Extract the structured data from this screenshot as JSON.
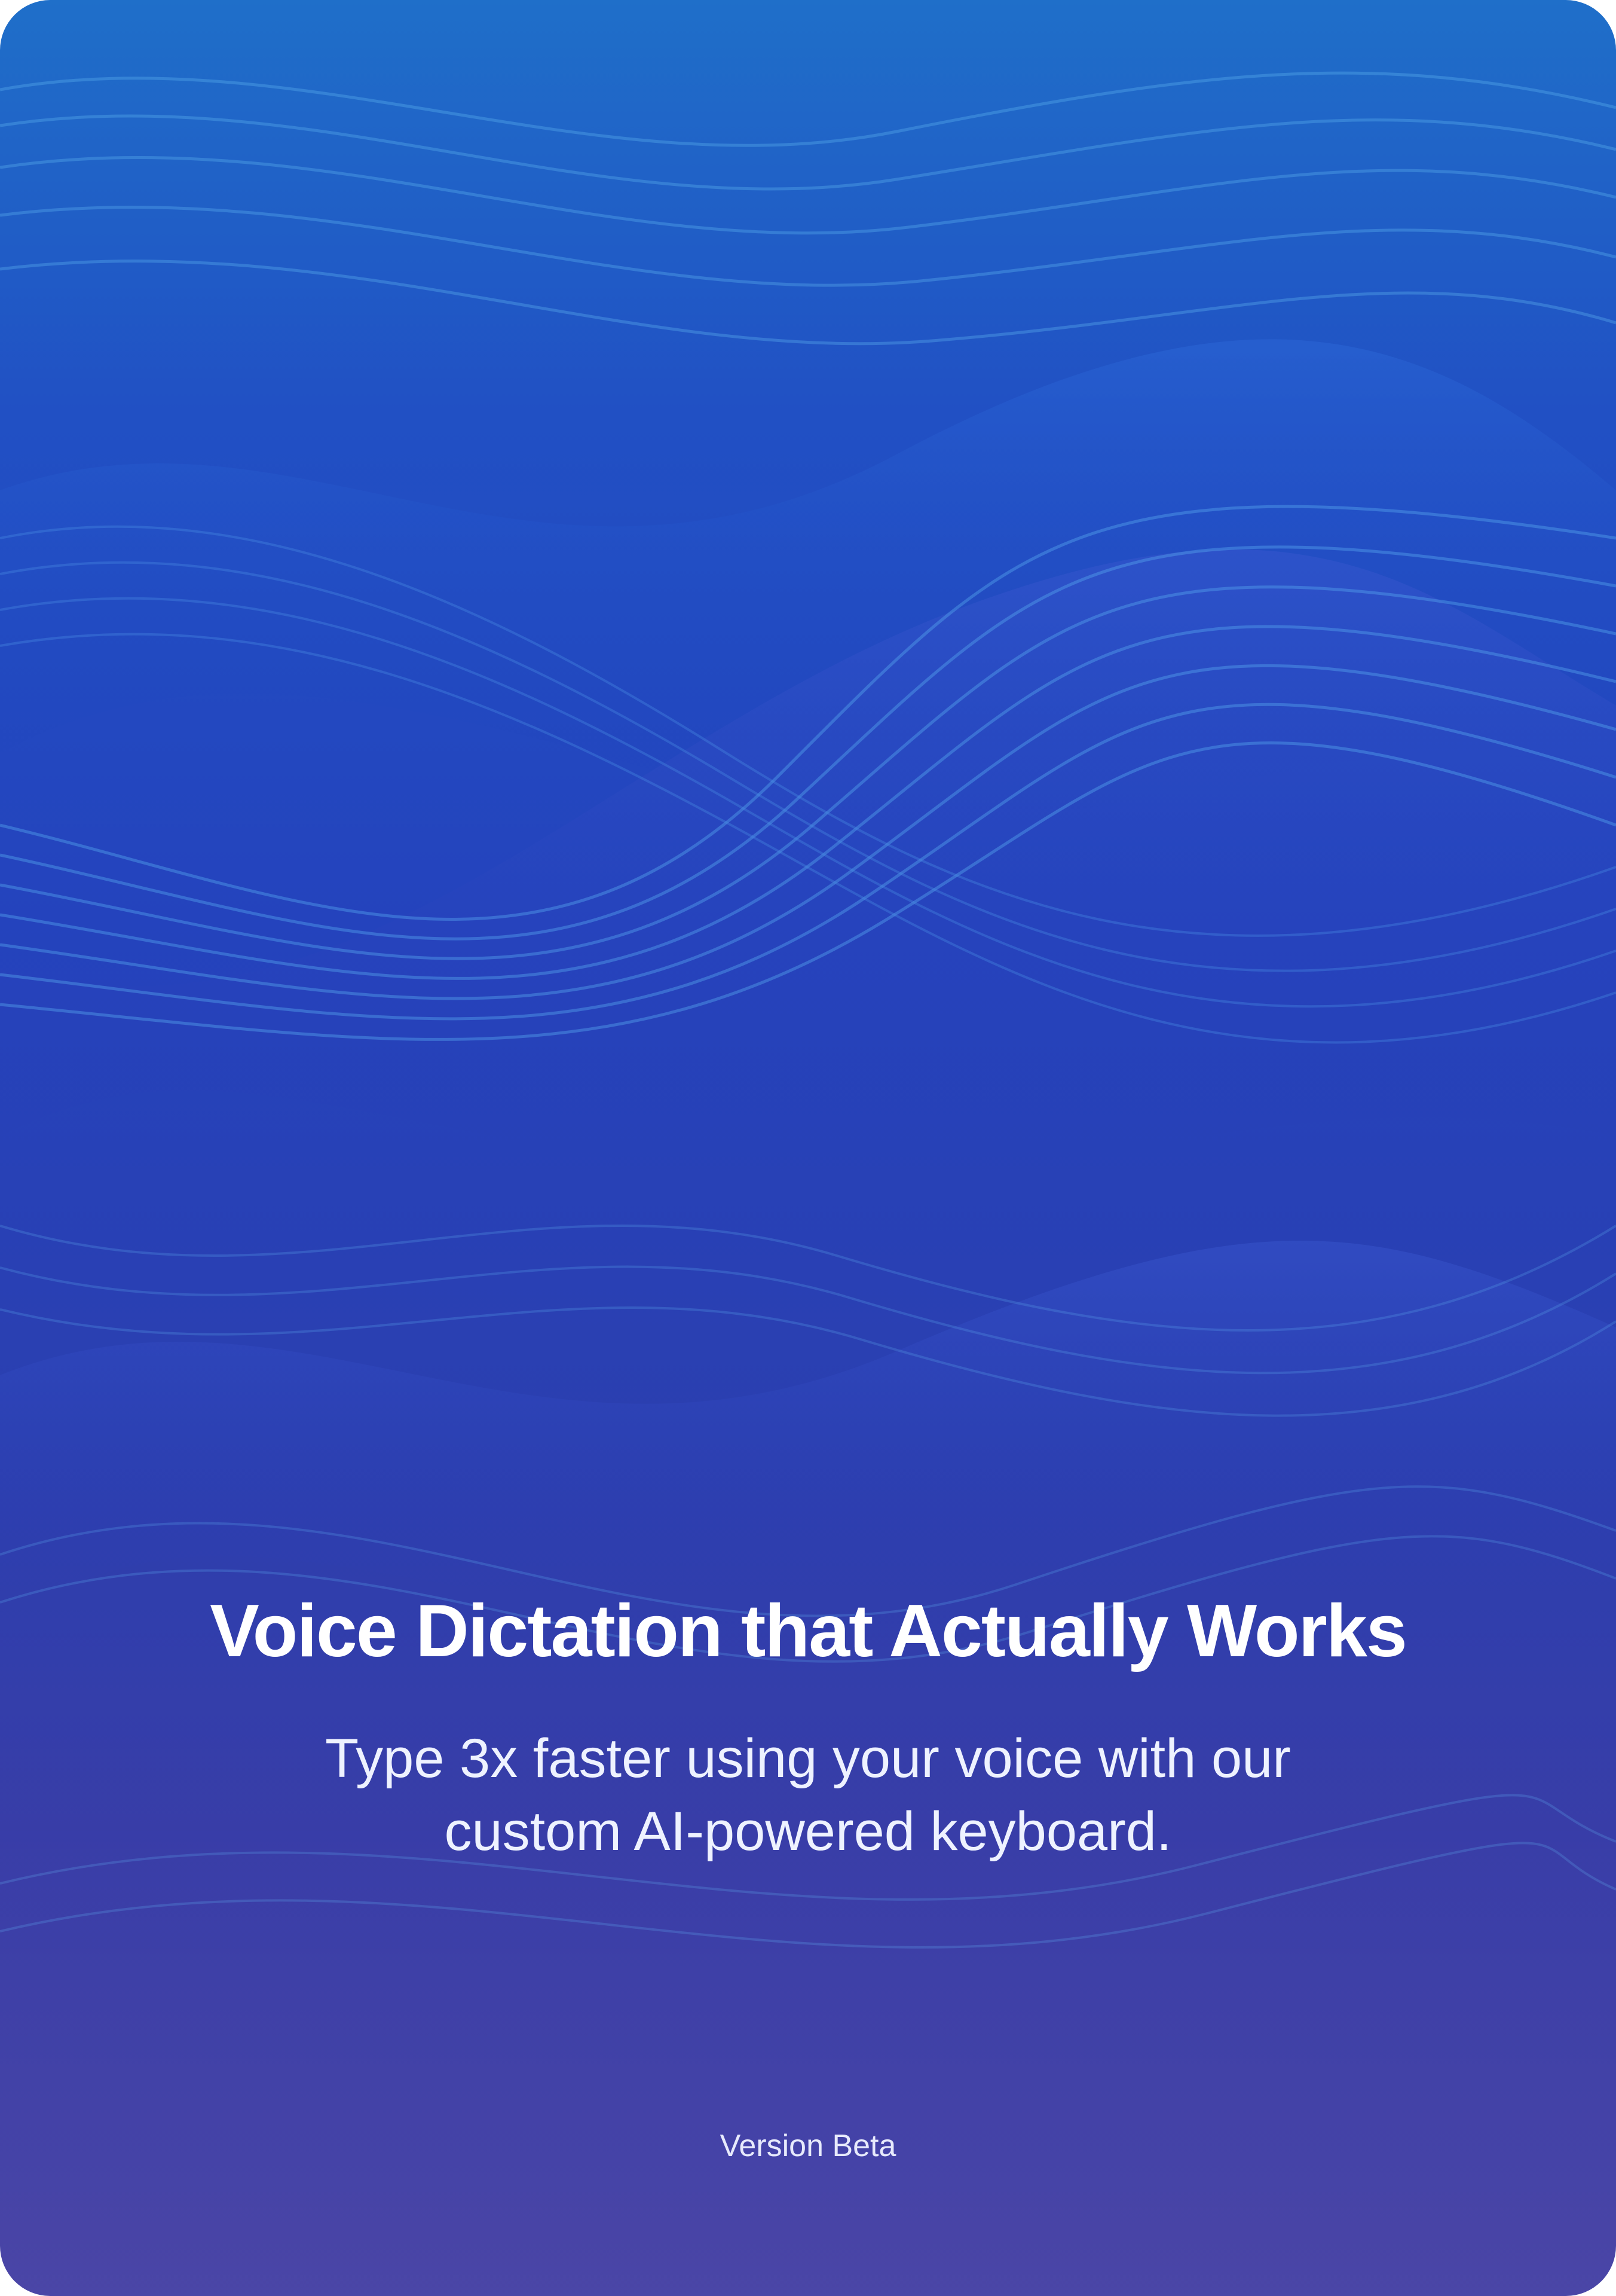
{
  "splash": {
    "headline": "Voice Dictation that Actually Works",
    "subtitle": "Type 3x faster using your voice with our custom AI-powered keyboard.",
    "version": "Version Beta"
  },
  "colors": {
    "background_top": "#1f6fc9",
    "background_middle": "#2443bd",
    "background_bottom": "#433ea3",
    "wave_highlight": "#4aa3f0",
    "text": "#ffffff"
  },
  "background": {
    "image": "abstract-blue-flowing-waves"
  }
}
